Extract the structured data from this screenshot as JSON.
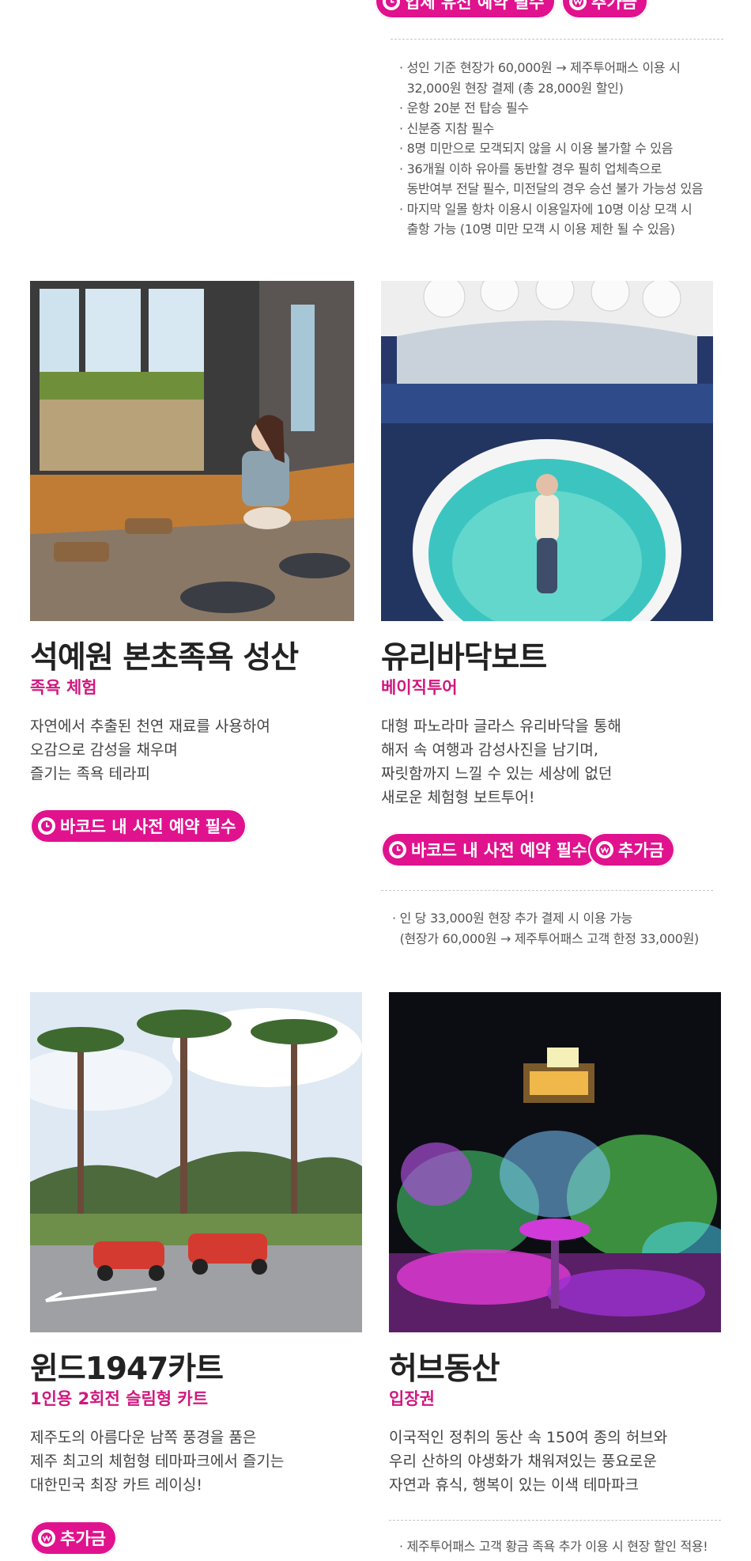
{
  "top": {
    "badges": [
      "업체 유선 예약 필수",
      "추가금"
    ],
    "notes": [
      "· 성인 기준 현장가 60,000원 → 제주투어패스 이용 시",
      "  32,000원 현장 결제 (총 28,000원 할인)",
      "· 운항 20분 전 탑승 필수",
      "· 신분증 지참 필수",
      "· 8명 미만으로 모객되지 않을 시 이용 불가할 수 있음",
      "· 36개월 이하 유아를 동반할 경우 필히 업체측으로",
      "  동반여부 전달 필수, 미전달의 경우 승선 불가 가능성 있음",
      "· 마지막 일몰 항차 이용시 이용일자에 10명 이상 모객 시",
      "  출항 가능 (10명 미만 모객 시 이용 제한 될 수 있음)"
    ]
  },
  "cards": [
    {
      "title": "석예원 본초족욕 성산",
      "subtitle": "족욕 체험",
      "desc": [
        "자연에서 추출된 천연 재료를 사용하여",
        "오감으로 감성을 채우며",
        "즐기는 족욕 테라피"
      ],
      "badges": [
        "바코드 내 사전 예약 필수"
      ],
      "notes": []
    },
    {
      "title": "유리바닥보트",
      "subtitle": "베이직투어",
      "desc": [
        "대형 파노라마 글라스 유리바닥을 통해",
        "해저 속 여행과 감성사진을 남기며,",
        "짜릿함까지 느낄 수 있는 세상에 없던",
        "새로운 체험형 보트투어!"
      ],
      "badges": [
        "바코드 내 사전 예약 필수",
        "추가금"
      ],
      "notes": [
        "· 인 당 33,000원 현장 추가 결제 시 이용 가능",
        "  (현장가 60,000원 → 제주투어패스 고객 한정 33,000원)"
      ]
    },
    {
      "title": "윈드1947카트",
      "subtitle": "1인용 2회전 슬림형 카트",
      "desc": [
        "제주도의 아름다운 남쪽 풍경을 품은",
        "제주 최고의 체험형 테마파크에서 즐기는",
        "대한민국 최장 카트 레이싱!"
      ],
      "badges": [
        "추가금"
      ],
      "notes": []
    },
    {
      "title": "허브동산",
      "subtitle": "입장권",
      "desc": [
        "이국적인 정취의 동산 속 150여 종의 허브와",
        "우리 산하의 야생화가 채워져있는 풍요로운",
        "자연과 휴식, 행복이 있는 이색 테마파크"
      ],
      "badges": [],
      "notes": [
        "· 제주투어패스 고객 황금 족욕 추가 이용 시 현장 할인 적용!"
      ]
    }
  ],
  "colors": {
    "accent": "#e0128e",
    "subtitle": "#d0187e"
  },
  "icons": {
    "clock": "clock-icon",
    "won": "won-coin-icon"
  }
}
